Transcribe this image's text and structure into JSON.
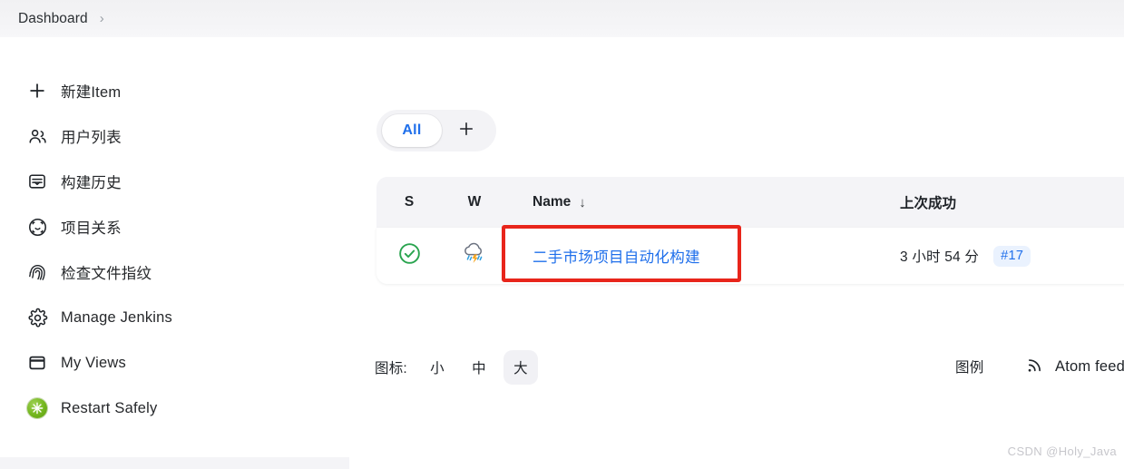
{
  "breadcrumb": {
    "items": [
      "Dashboard"
    ],
    "separator": "›"
  },
  "sidebar": {
    "items": [
      {
        "label": "新建Item",
        "icon": "plus-icon"
      },
      {
        "label": "用户列表",
        "icon": "people-icon"
      },
      {
        "label": "构建历史",
        "icon": "inbox-icon"
      },
      {
        "label": "项目关系",
        "icon": "relationship-icon"
      },
      {
        "label": "检查文件指纹",
        "icon": "fingerprint-icon"
      },
      {
        "label": "Manage Jenkins",
        "icon": "gear-icon"
      },
      {
        "label": "My Views",
        "icon": "window-icon"
      },
      {
        "label": "Restart Safely",
        "icon": "restart-safely-icon"
      }
    ]
  },
  "main": {
    "tabs": {
      "all_label": "All",
      "add_label": "+"
    },
    "table": {
      "headers": {
        "status": "S",
        "weather": "W",
        "name": "Name",
        "name_sort": "↓",
        "last_success": "上次成功"
      },
      "rows": [
        {
          "status_icon": "check-circle-icon",
          "weather_icon": "stormy-weather-icon",
          "name": "二手市场项目自动化构建",
          "last_success": "3 小时 54 分",
          "build_number": "#17"
        }
      ]
    },
    "footer": {
      "icon_size_label": "图标:",
      "sizes": [
        {
          "label": "小",
          "active": false
        },
        {
          "label": "中",
          "active": false
        },
        {
          "label": "大",
          "active": true
        }
      ],
      "legend_label": "图例",
      "atom_feed_label": "Atom feed"
    }
  },
  "watermark": "CSDN @Holy_Java",
  "colors": {
    "link_blue": "#1f6feb",
    "status_green": "#2aa44f",
    "highlight_red": "#e8251b",
    "badge_bg": "#eaf2fe",
    "header_bg": "#f4f4f7"
  }
}
